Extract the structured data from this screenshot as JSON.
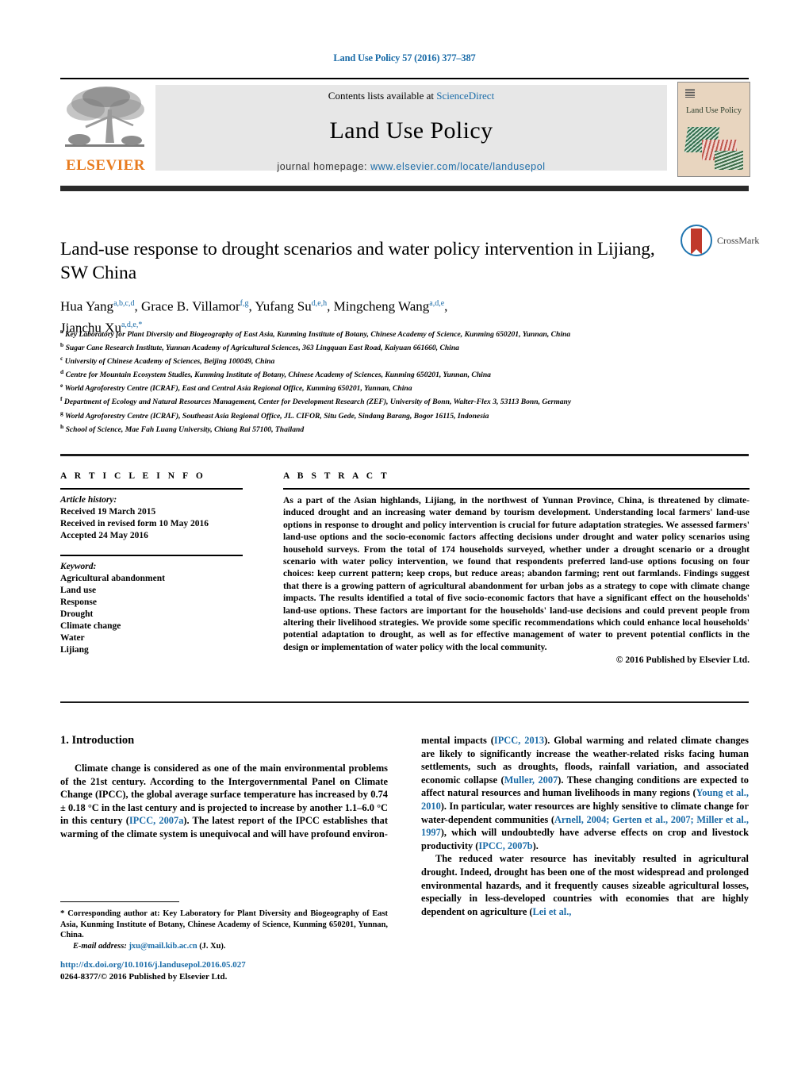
{
  "running_head": "Land Use Policy 57 (2016) 377–387",
  "masthead": {
    "contents_prefix": "Contents lists available at ",
    "sciencedirect": "ScienceDirect",
    "journal_title": "Land Use Policy",
    "homepage_label": "journal homepage: ",
    "homepage_url": "www.elsevier.com/locate/landusepol",
    "publisher": "ELSEVIER",
    "cover_title": "Land Use Policy",
    "tree_icon": "elsevier-tree-icon"
  },
  "crossmark": {
    "label": "CrossMark",
    "icon": "crossmark-icon"
  },
  "article": {
    "title": "Land-use response to drought scenarios and water policy intervention in Lijiang, SW China",
    "authors_line1": "Hua Yang a,b,c,d, Grace B. Villamor f,g, Yufang Su d,e,h, Mingcheng Wang a,d,e,",
    "authors_line2": "Jianchu Xu a,d,e,*",
    "affiliations": [
      {
        "marker": "a",
        "text": "Key Laboratory for Plant Diversity and Biogeography of East Asia, Kunming Institute of Botany, Chinese Academy of Science, Kunming 650201, Yunnan, China"
      },
      {
        "marker": "b",
        "text": "Sugar Cane Research Institute, Yunnan Academy of Agricultural Sciences, 363 Lingquan East Road, Kaiyuan 661660, China"
      },
      {
        "marker": "c",
        "text": "University of Chinese Academy of Sciences, Beijing 100049, China"
      },
      {
        "marker": "d",
        "text": "Centre for Mountain Ecosystem Studies, Kunming Institute of Botany, Chinese Academy of Sciences, Kunming 650201, Yunnan, China"
      },
      {
        "marker": "e",
        "text": "World Agroforestry Centre (ICRAF), East and Central Asia Regional Office, Kunming 650201, Yunnan, China"
      },
      {
        "marker": "f",
        "text": "Department of Ecology and Natural Resources Management, Center for Development Research (ZEF), University of Bonn, Walter-Flex 3, 53113 Bonn, Germany"
      },
      {
        "marker": "g",
        "text": "World Agroforestry Centre (ICRAF), Southeast Asia Regional Office, JL. CIFOR, Situ Gede, Sindang Barang, Bogor 16115, Indonesia"
      },
      {
        "marker": "h",
        "text": "School of Science, Mae Fah Luang University, Chiang Rai 57100, Thailand"
      }
    ]
  },
  "article_info": {
    "heading": "A R T I C L E   I N F O",
    "history_label": "Article history:",
    "history": [
      "Received 19 March 2015",
      "Received in revised form 10 May 2016",
      "Accepted 24 May 2016"
    ],
    "keyword_label": "Keyword:",
    "keywords": [
      "Agricultural abandonment",
      "Land use",
      "Response",
      "Drought",
      "Climate change",
      "Water",
      "Lijiang"
    ]
  },
  "abstract": {
    "heading": "A B S T R A C T",
    "text": "As a part of the Asian highlands, Lijiang, in the northwest of Yunnan Province, China, is threatened by climate-induced drought and an increasing water demand by tourism development. Understanding local farmers' land-use options in response to drought and policy intervention is crucial for future adaptation strategies. We assessed farmers' land-use options and the socio-economic factors affecting decisions under drought and water policy scenarios using household surveys. From the total of 174 households surveyed, whether under a drought scenario or a drought scenario with water policy intervention, we found that respondents preferred land-use options focusing on four choices: keep current pattern; keep crops, but reduce areas; abandon farming; rent out farmlands. Findings suggest that there is a growing pattern of agricultural abandonment for urban jobs as a strategy to cope with climate change impacts. The results identified a total of five socio-economic factors that have a significant effect on the households' land-use options. These factors are important for the households' land-use decisions and could prevent people from altering their livelihood strategies. We provide some specific recommendations which could enhance local households' potential adaptation to drought, as well as for effective management of water to prevent potential conflicts in the design or implementation of water policy with the local community.",
    "copyright": "© 2016 Published by Elsevier Ltd."
  },
  "body": {
    "section1_heading": "1.  Introduction",
    "left_para1_a": "Climate change is considered as one of the main environmental problems of the 21st century. According to the Intergovernmental Panel on Climate Change (IPCC), the global average surface temperature has increased by 0.74 ± 0.18 °C in the last century and is projected to increase by another 1.1–6.0 °C in this century (",
    "left_para1_ref1": "IPCC, 2007a",
    "left_para1_b": "). The latest report of the IPCC establishes that warming of the climate system is unequivocal and will have profound environ-",
    "right_para1_a": "mental impacts (",
    "right_para1_ref1": "IPCC, 2013",
    "right_para1_b": "). Global warming and related climate changes are likely to significantly increase the weather-related risks facing human settlements, such as droughts, floods, rainfall variation, and associated economic collapse (",
    "right_para1_ref2": "Muller, 2007",
    "right_para1_c": "). These changing conditions are expected to affect natural resources and human livelihoods in many regions (",
    "right_para1_ref3": "Young et al., 2010",
    "right_para1_d": "). In particular, water resources are highly sensitive to climate change for water-dependent communities (",
    "right_para1_ref4": "Arnell, 2004; Gerten et al., 2007; Miller et al., 1997",
    "right_para1_e": "), which will undoubtedly have adverse effects on crop and livestock productivity (",
    "right_para1_ref5": "IPCC, 2007b",
    "right_para1_f": ").",
    "right_para2_a": "The reduced water resource has inevitably resulted in agricultural drought. Indeed, drought has been one of the most widespread and prolonged environmental hazards, and it frequently causes sizeable agricultural losses, especially in less-developed countries with economies that are highly dependent on agriculture (",
    "right_para2_ref1": "Lei et al.,",
    "right_para2_b": ""
  },
  "footnote": {
    "star": "*",
    "corresponding": " Corresponding author at: Key Laboratory for Plant Diversity and Biogeography of East Asia, Kunming Institute of Botany, Chinese Academy of Science, Kunming 650201, Yunnan, China.",
    "email_label": "E-mail address:",
    "email": "jxu@mail.kib.ac.cn",
    "email_suffix": " (J. Xu)."
  },
  "doi_block": {
    "doi": "http://dx.doi.org/10.1016/j.landusepol.2016.05.027",
    "issn_line": "0264-8377/© 2016 Published by Elsevier Ltd."
  },
  "colors": {
    "link": "#1b6ca8",
    "elsevier_orange": "#E87B1E",
    "band": "#e7e7e7",
    "rule": "#2a2a2a"
  }
}
